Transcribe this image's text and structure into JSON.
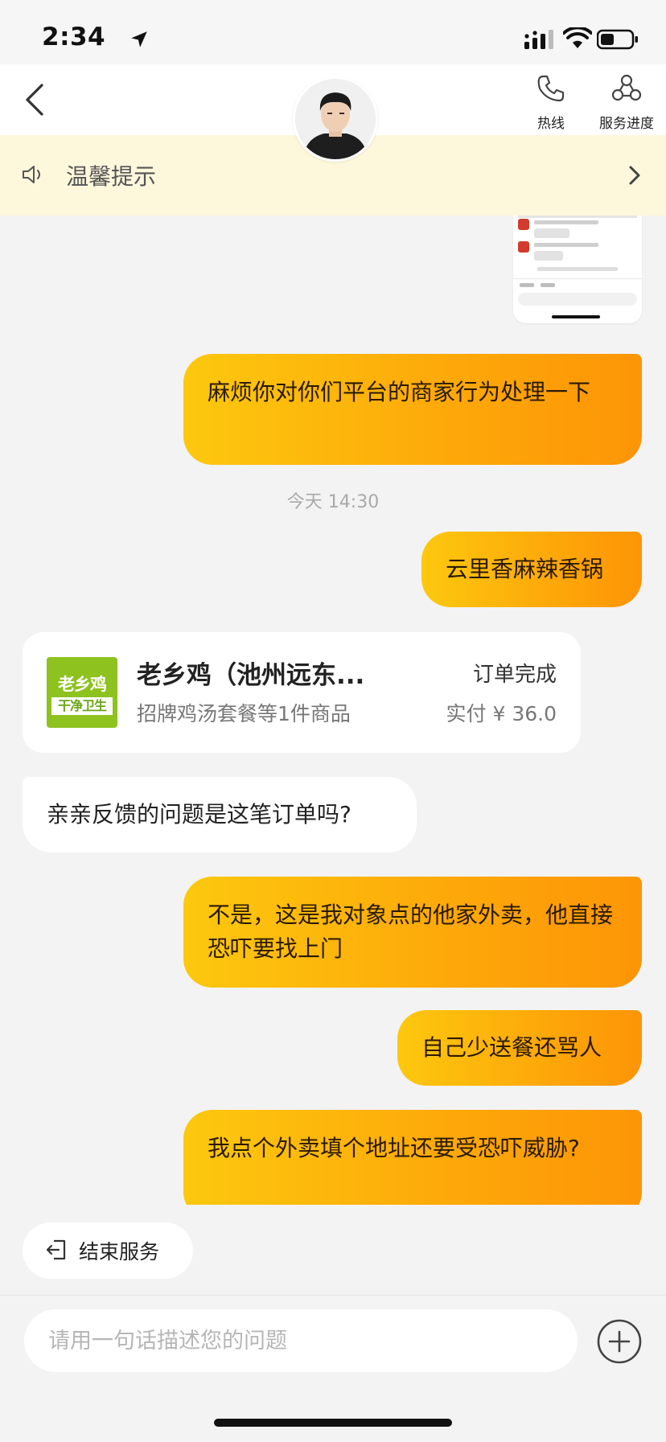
{
  "status_bar": {
    "time": "2:34"
  },
  "header": {
    "hotline_label": "热线",
    "progress_label": "服务进度"
  },
  "notice": {
    "text": "温馨提示"
  },
  "messages": {
    "m1": "麻烦你对你们平台的商家行为处理一下",
    "timestamp": "今天 14:30",
    "m2": "云里香麻辣香锅",
    "m3": "亲亲反馈的问题是这笔订单吗?",
    "m4": "不是，这是我对象点的他家外卖，他直接恐吓要找上门",
    "m5": "自己少送餐还骂人",
    "m6": "我点个外卖填个地址还要受恐吓威胁?"
  },
  "order_card": {
    "logo_top": "老乡鸡",
    "logo_bottom": "干净卫生",
    "shop_name": "老乡鸡（池州远东...",
    "items": "招牌鸡汤套餐等1件商品",
    "status": "订单完成",
    "paid": "实付 ¥ 36.0"
  },
  "end_service": {
    "label": "结束服务"
  },
  "input": {
    "placeholder": "请用一句话描述您的问题"
  },
  "colors": {
    "bubble_out_start": "#fdc80e",
    "bubble_out_end": "#fd9506",
    "notice_bg": "#fdf7dc",
    "logo_green": "#8dc21f"
  },
  "icons": [
    "navigation-arrow-icon",
    "signal-icon",
    "wifi-icon",
    "battery-icon",
    "back-icon",
    "phone-icon",
    "service-progress-icon",
    "speaker-icon",
    "chevron-right-icon",
    "exit-icon",
    "plus-icon"
  ]
}
